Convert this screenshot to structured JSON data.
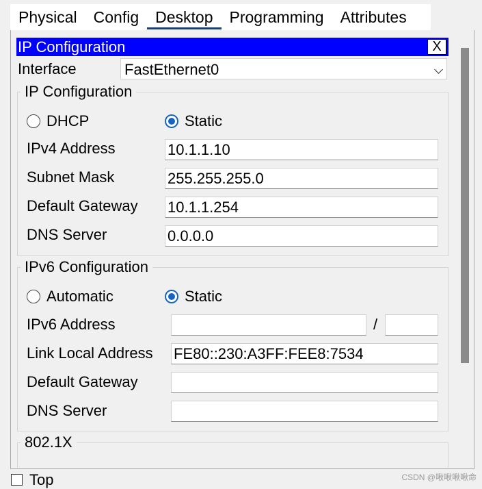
{
  "tabs": [
    {
      "label": "Physical"
    },
    {
      "label": "Config"
    },
    {
      "label": "Desktop"
    },
    {
      "label": "Programming"
    },
    {
      "label": "Attributes"
    }
  ],
  "active_tab": "Desktop",
  "window": {
    "title": "IP Configuration",
    "close_label": "X"
  },
  "interface": {
    "label": "Interface",
    "value": "FastEthernet0"
  },
  "ipv4": {
    "group_title": "IP Configuration",
    "dhcp_label": "DHCP",
    "static_label": "Static",
    "mode": "Static",
    "address_label": "IPv4 Address",
    "address_value": "10.1.1.10",
    "mask_label": "Subnet Mask",
    "mask_value": "255.255.255.0",
    "gateway_label": "Default Gateway",
    "gateway_value": "10.1.1.254",
    "dns_label": "DNS Server",
    "dns_value": "0.0.0.0"
  },
  "ipv6": {
    "group_title": "IPv6 Configuration",
    "auto_label": "Automatic",
    "static_label": "Static",
    "mode": "Static",
    "address_label": "IPv6 Address",
    "address_value": "",
    "prefix_sep": "/",
    "prefix_value": "",
    "link_local_label": "Link Local Address",
    "link_local_value": "FE80::230:A3FF:FEE8:7534",
    "gateway_label": "Default Gateway",
    "gateway_value": "",
    "dns_label": "DNS Server",
    "dns_value": ""
  },
  "dot1x": {
    "group_title": "802.1X"
  },
  "footer": {
    "top_label": "Top"
  },
  "watermark": "CSDN @啾啾啾啾命"
}
